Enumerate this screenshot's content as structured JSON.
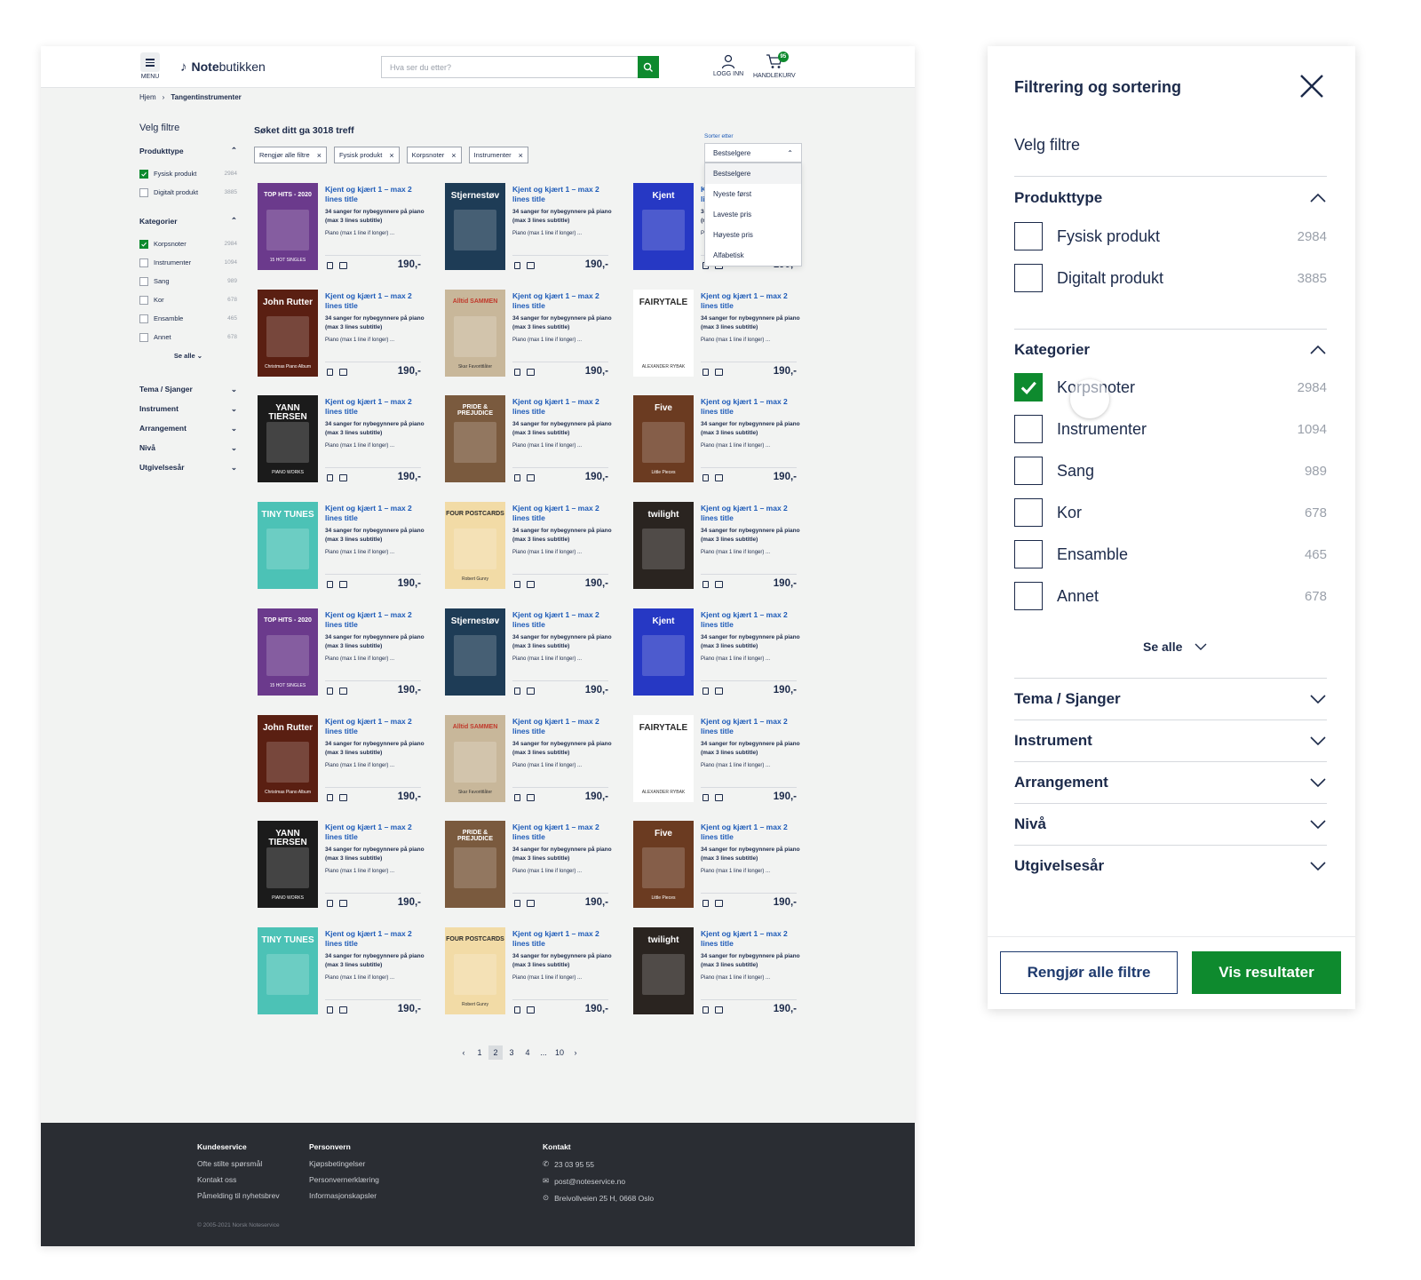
{
  "header": {
    "menu_label": "MENU",
    "logo_bold": "Note",
    "logo_rest": "butikken",
    "search_placeholder": "Hva ser du etter?",
    "login_label": "LOGG INN",
    "cart_label": "HANDLEKURV",
    "cart_count": "95"
  },
  "breadcrumb": {
    "home": "Hjem",
    "current": "Tangentinstrumenter"
  },
  "sidebar": {
    "title": "Velg filtre",
    "product_type": {
      "heading": "Produkttype",
      "items": [
        {
          "label": "Fysisk produkt",
          "count": "2984",
          "checked": true
        },
        {
          "label": "Digitalt produkt",
          "count": "3885",
          "checked": false
        }
      ]
    },
    "categories": {
      "heading": "Kategorier",
      "items": [
        {
          "label": "Korpsnoter",
          "count": "2984",
          "checked": true
        },
        {
          "label": "Instrumenter",
          "count": "1094",
          "checked": false
        },
        {
          "label": "Sang",
          "count": "989",
          "checked": false
        },
        {
          "label": "Kor",
          "count": "678",
          "checked": false
        },
        {
          "label": "Ensamble",
          "count": "465",
          "checked": false
        },
        {
          "label": "Annet",
          "count": "678",
          "checked": false
        }
      ],
      "see_all": "Se alle"
    },
    "collapsed": [
      "Tema / Sjanger",
      "Instrument",
      "Arrangement",
      "Nivå",
      "Utgivelsesår"
    ]
  },
  "results": {
    "title": "Søket ditt ga 3018 treff",
    "chips": [
      "Rengjør alle filtre",
      "Fysisk produkt",
      "Korpsnoter",
      "Instrumenter"
    ],
    "sort": {
      "label": "Sorter etter",
      "selected": "Bestselgere",
      "options": [
        "Bestselgere",
        "Nyeste først",
        "Laveste pris",
        "Høyeste pris",
        "Alfabetisk"
      ]
    },
    "product": {
      "title": "Kjent og kjært 1 – max 2 lines title",
      "subtitle": "34 sanger for nybegynnere på piano (max 3 lines subtitle)",
      "instrument": "Piano (max 1 line if longer) ...",
      "price": "190,-"
    },
    "covers": [
      {
        "title": "TOP HITS - 2020",
        "sub": "15 HOT SINGLES",
        "bg": "#6b3a8c"
      },
      {
        "title": "Stjernestøv",
        "sub": "",
        "bg": "#1e3c56"
      },
      {
        "title": "Kjent",
        "sub": "",
        "bg": "#2638c4"
      },
      {
        "title": "John Rutter",
        "sub": "Christmas Piano Album",
        "bg": "#5a1f12"
      },
      {
        "title": "Alltid SAMMEN",
        "sub": "Skar Favorittlåter",
        "bg": "#c8b79a"
      },
      {
        "title": "FAIRYTALE",
        "sub": "ALEXANDER RYBAK",
        "bg": "#ffffff"
      },
      {
        "title": "YANN TIERSEN",
        "sub": "PIANO WORKS",
        "bg": "#1b1b1b"
      },
      {
        "title": "PRIDE & PREJUDICE",
        "sub": "",
        "bg": "#7a5a3e"
      },
      {
        "title": "Five",
        "sub": "Little Pieces",
        "bg": "#6b3b21"
      },
      {
        "title": "TINY TUNES",
        "sub": "",
        "bg": "#4cc2b6"
      },
      {
        "title": "FOUR POSTCARDS",
        "sub": "Robert Gunry",
        "bg": "#f2dba6"
      },
      {
        "title": "twilight",
        "sub": "",
        "bg": "#2a2420"
      }
    ],
    "pagination": [
      "‹",
      "1",
      "2",
      "3",
      "4",
      "...",
      "10",
      "›"
    ],
    "current_page": "2"
  },
  "footer": {
    "kundeservice": {
      "heading": "Kundeservice",
      "links": [
        "Ofte stilte spørsmål",
        "Kontakt oss",
        "Påmelding til nyhetsbrev"
      ]
    },
    "personvern": {
      "heading": "Personvern",
      "links": [
        "Kjøpsbetingelser",
        "Personvernerklæring",
        "Informasjonskapsler"
      ]
    },
    "kontakt": {
      "heading": "Kontakt",
      "phone": "23 03 95 55",
      "email": "post@noteservice.no",
      "address": "Breivollveien 25 H, 0668 Oslo"
    },
    "copyright": "© 2005-2021 Norsk Noteservice"
  },
  "panel": {
    "title": "Filtrering og sortering",
    "subtitle": "Velg filtre",
    "product_type": {
      "heading": "Produkttype",
      "items": [
        {
          "label": "Fysisk produkt",
          "count": "2984",
          "checked": false
        },
        {
          "label": "Digitalt produkt",
          "count": "3885",
          "checked": false
        }
      ]
    },
    "categories": {
      "heading": "Kategorier",
      "items": [
        {
          "label": "Korpsnoter",
          "count": "2984",
          "checked": true
        },
        {
          "label": "Instrumenter",
          "count": "1094",
          "checked": false
        },
        {
          "label": "Sang",
          "count": "989",
          "checked": false
        },
        {
          "label": "Kor",
          "count": "678",
          "checked": false
        },
        {
          "label": "Ensamble",
          "count": "465",
          "checked": false
        },
        {
          "label": "Annet",
          "count": "678",
          "checked": false
        }
      ],
      "see_all": "Se alle"
    },
    "collapsed": [
      "Tema / Sjanger",
      "Instrument",
      "Arrangement",
      "Nivå",
      "Utgivelsesår"
    ],
    "clear_button": "Rengjør alle filtre",
    "show_button": "Vis resultater"
  },
  "colors": {
    "accent_green": "#0e8a2e",
    "navy": "#1c2a4a",
    "link_blue": "#1e5bb8",
    "footer_bg": "#2a2d33"
  }
}
